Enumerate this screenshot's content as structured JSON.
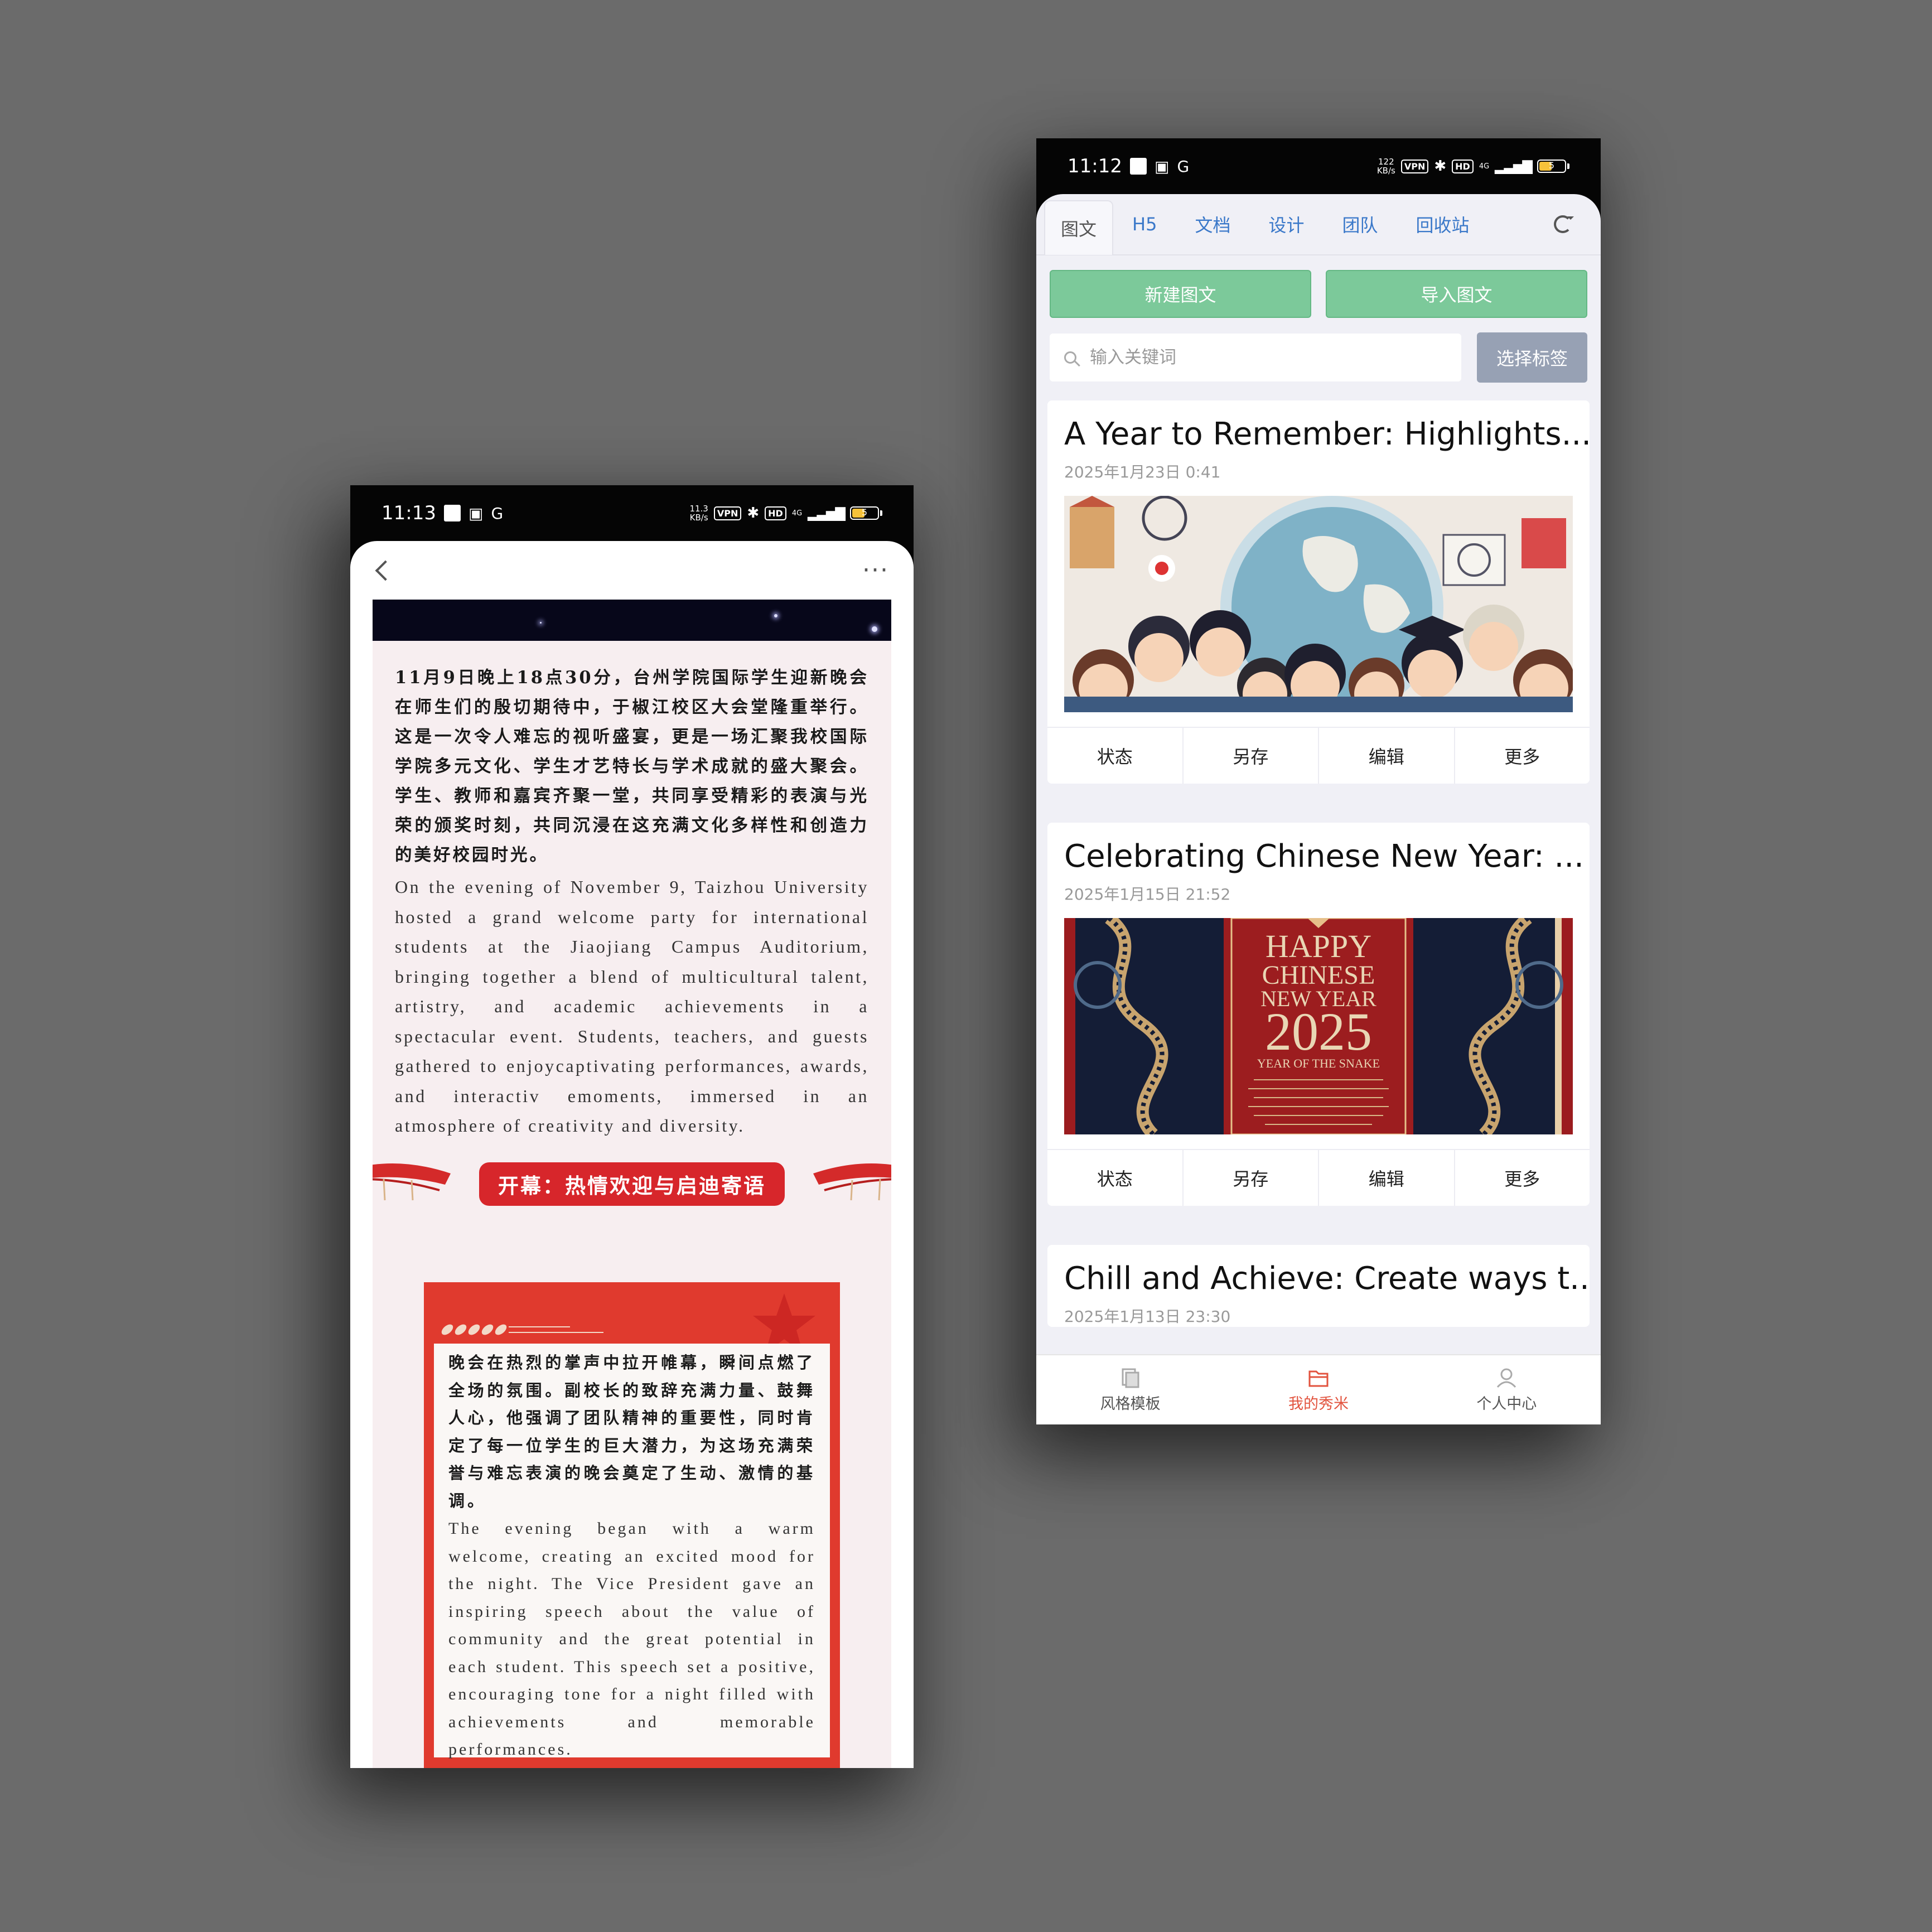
{
  "left_phone": {
    "status": {
      "time": "11:13",
      "speed": "11.3\nKB/s",
      "vpn": "VPN",
      "network": "4G",
      "battery": "5"
    },
    "article": {
      "cn_intro": "11月9日晚上18点30分，台州学院国际学生迎新晚会在师生们的殷切期待中，于椒江校区大会堂隆重举行。这是一次令人难忘的视听盛宴，更是一场汇聚我校国际学院多元文化、学生才艺特长与学术成就的盛大聚会。学生、教师和嘉宾齐聚一堂，共同享受精彩的表演与光荣的颁奖时刻，共同沉浸在这充满文化多样性和创造力的美好校园时光。",
      "en_intro": "On the evening of November 9, Taizhou University hosted a grand welcome party for international students at the Jiaojiang Campus Auditorium, bringing together a blend of multicultural talent, artistry, and academic achievements in a spectacular event. Students, teachers, and guests gathered to enjoycaptivating performances, awards, and interactiv emoments, immersed in an atmosphere of creativity and diversity.",
      "section_title": "开幕：热情欢迎与启迪寄语",
      "cn_section": "晚会在热烈的掌声中拉开帷幕，瞬间点燃了全场的氛围。副校长的致辞充满力量、鼓舞人心，他强调了团队精神的重要性，同时肯定了每一位学生的巨大潜力，为这场充满荣誉与难忘表演的晚会奠定了生动、激情的基调。",
      "en_section": "The evening began with a warm welcome, creating an excited mood for the night. The Vice President gave an inspiring speech about the value of community and the great potential in each student. This speech set a positive, encouraging tone for a night filled with achievements and memorable performances."
    }
  },
  "right_phone": {
    "status": {
      "time": "11:12",
      "speed": "122\nKB/s",
      "vpn": "VPN",
      "network": "4G",
      "battery": "5"
    },
    "tabs": [
      "图文",
      "H5",
      "文档",
      "设计",
      "团队",
      "回收站"
    ],
    "buttons": {
      "new": "新建图文",
      "import": "导入图文"
    },
    "search": {
      "placeholder": "输入关键词",
      "tag_button": "选择标签"
    },
    "cards": [
      {
        "title": "A Year to Remember: Highlights...",
        "date": "2025年1月23日 0:41"
      },
      {
        "title": "Celebrating Chinese New Year:  ...",
        "date": "2025年1月15日 21:52",
        "image_text": [
          "HAPPY",
          "CHINESE",
          "NEW YEAR",
          "2025",
          "YEAR OF THE SNAKE"
        ]
      },
      {
        "title": "Chill and Achieve: Create ways t...",
        "date": "2025年1月13日 23:30"
      }
    ],
    "card_actions": [
      "状态",
      "另存",
      "编辑",
      "更多"
    ],
    "bottom_nav": [
      "风格模板",
      "我的秀米",
      "个人中心"
    ],
    "colors": {
      "green": "#7cc99a",
      "link_blue": "#3a78c9",
      "active_nav": "#e2533e",
      "tag_btn": "#97a1b4"
    }
  }
}
